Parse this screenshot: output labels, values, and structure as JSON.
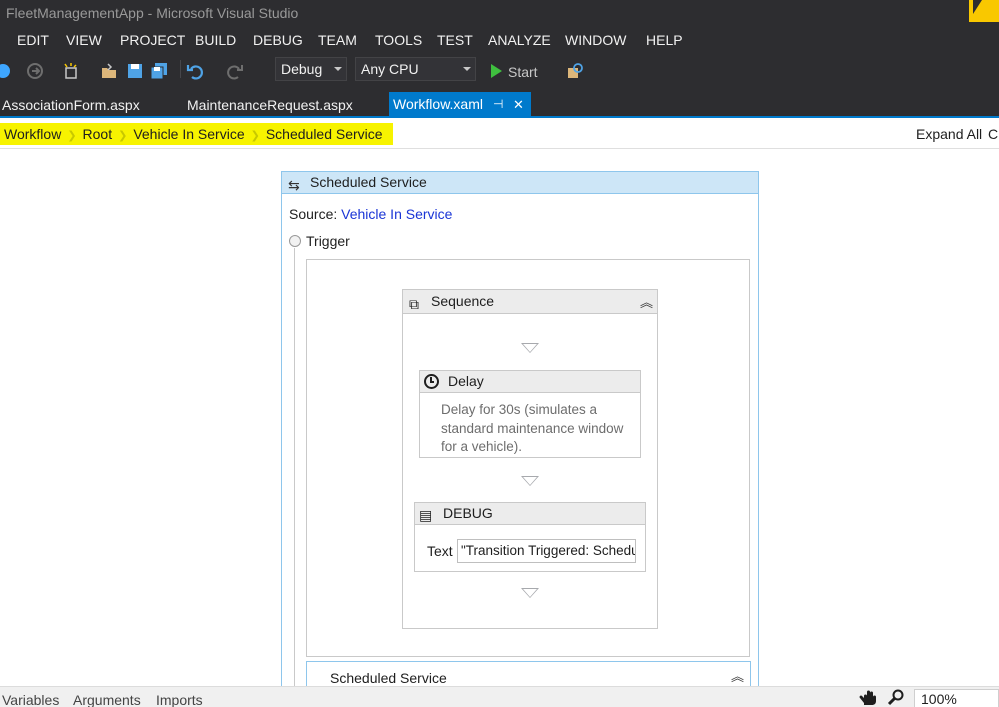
{
  "window": {
    "title": "FleetManagementApp - Microsoft Visual Studio"
  },
  "menu": [
    "EDIT",
    "VIEW",
    "PROJECT",
    "BUILD",
    "DEBUG",
    "TEAM",
    "TOOLS",
    "TEST",
    "ANALYZE",
    "WINDOW",
    "HELP"
  ],
  "toolbar": {
    "config": "Debug",
    "platform": "Any CPU",
    "start": "Start"
  },
  "tabs": [
    {
      "label": "AssociationForm.aspx"
    },
    {
      "label": "MaintenanceRequest.aspx"
    },
    {
      "label": "Workflow.xaml",
      "active": true
    }
  ],
  "breadcrumb": [
    "Workflow",
    "Root",
    "Vehicle In Service",
    "Scheduled Service"
  ],
  "breadcrumb_right": {
    "expand_all": "Expand All",
    "collapse_partial": "C"
  },
  "state": {
    "title": "Scheduled Service",
    "source_label": "Source:",
    "source_value": "Vehicle In Service",
    "trigger_label": "Trigger",
    "sequence": {
      "title": "Sequence",
      "delay": {
        "title": "Delay",
        "description": "Delay for 30s (simulates a standard maintenance window for a vehicle)."
      },
      "debug": {
        "title": "DEBUG",
        "text_label": "Text",
        "text_value": "\"Transition Triggered: Scheduled Service\""
      }
    },
    "transition_title": "Scheduled Service"
  },
  "bottom": {
    "variables": "Variables",
    "arguments": "Arguments",
    "imports": "Imports",
    "zoom": "100%"
  },
  "colors": {
    "highlight": "#f7f300",
    "accent": "#007acc",
    "state_header": "#cde6f7",
    "link": "#1a35d6"
  }
}
